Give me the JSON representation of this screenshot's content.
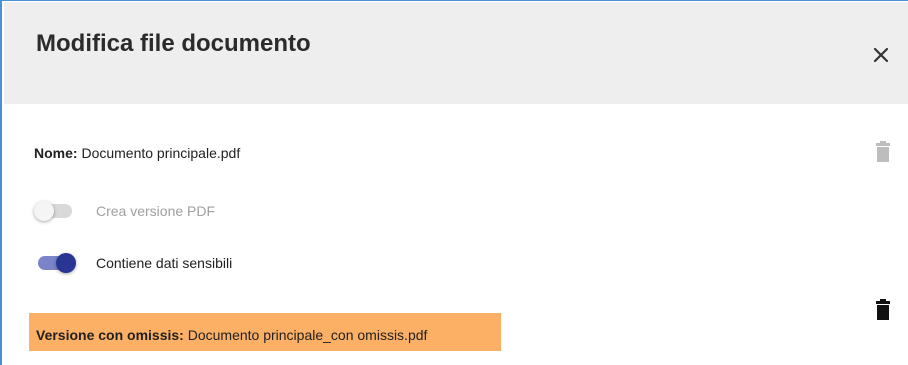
{
  "dialog": {
    "title": "Modifica file documento",
    "close_icon": "close-icon"
  },
  "file": {
    "name_label": "Nome:",
    "name_value": "Documento principale.pdf",
    "delete_icon": "trash-icon"
  },
  "options": {
    "pdf_version_label": "Crea versione PDF",
    "pdf_version_enabled": false,
    "pdf_version_disabled": true,
    "sensitive_data_label": "Contiene dati sensibili",
    "sensitive_data_enabled": true
  },
  "omissis": {
    "label": "Versione con omissis:",
    "value": "Documento principale_con omissis.pdf",
    "highlight_color": "#fcb065",
    "delete_icon": "trash-icon"
  },
  "colors": {
    "accent": "#283593",
    "header_bg": "#eeeeee",
    "border": "#4a90d9"
  }
}
